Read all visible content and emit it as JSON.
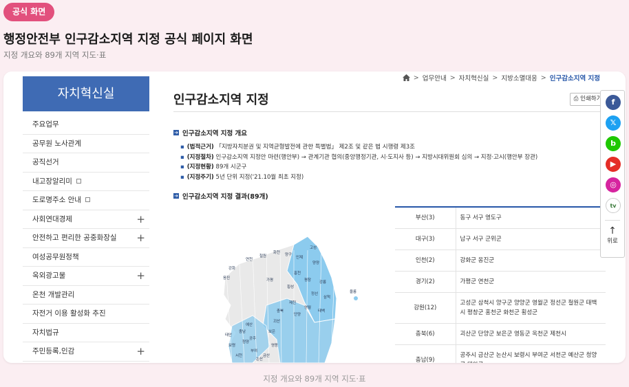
{
  "header": {
    "tag": "공식 화면",
    "headline": "행정안전부 인구감소지역 지정 공식 페이지 화면",
    "subline": "지정 개요와 89개 지역 지도·표",
    "caption": "지정 개요와 89개 지역 지도·표"
  },
  "sidebar": {
    "title": "자치혁신실",
    "items": [
      {
        "label": "주요업무",
        "ext": false,
        "plus": false
      },
      {
        "label": "공무원 노사관계",
        "ext": false,
        "plus": false
      },
      {
        "label": "공직선거",
        "ext": false,
        "plus": false
      },
      {
        "label": "내고장알리미",
        "ext": true,
        "plus": false
      },
      {
        "label": "도로명주소 안내",
        "ext": true,
        "plus": false
      },
      {
        "label": "사회연대경제",
        "ext": false,
        "plus": true
      },
      {
        "label": "안전하고 편리한 공중화장실",
        "ext": false,
        "plus": true
      },
      {
        "label": "여성공무원정책",
        "ext": false,
        "plus": false
      },
      {
        "label": "옥외광고물",
        "ext": false,
        "plus": true
      },
      {
        "label": "온천 개발관리",
        "ext": false,
        "plus": false
      },
      {
        "label": "자전거 이용 활성화 추진",
        "ext": false,
        "plus": false
      },
      {
        "label": "자치법규",
        "ext": false,
        "plus": false
      },
      {
        "label": "주민등록,인감",
        "ext": false,
        "plus": true
      }
    ]
  },
  "breadcrumb": [
    "업무안내",
    "자치혁신실",
    "지방소멸대응",
    "인구감소지역 지정"
  ],
  "page": {
    "title": "인구감소지역 지정",
    "print_label": "인쇄하기",
    "section1": "인구감소지역 지정 개요",
    "bullets": [
      {
        "key": "(법적근거)",
        "text": " 「지방자치분권 및 지역균형발전에 관한 특별법」 제2조 및 같은 법 시행령 제3조"
      },
      {
        "key": "(지정절차)",
        "text": " 인구감소지역 지정안 마련(행안부) → 관계기관 협의(중앙행정기관, 시·도지사 등) → 지방시대위원회 심의 → 지정·고시(행안부 장관)"
      },
      {
        "key": "(지정현황)",
        "text": " 89개 시군구"
      },
      {
        "key": "(지정주기)",
        "text": " 5년 단위 지정('21.10월 최초 지정)"
      }
    ],
    "section2": "인구감소지역 지정 결과(89개)"
  },
  "table": [
    {
      "region": "부산(3)",
      "list": "동구 서구 영도구"
    },
    {
      "region": "대구(3)",
      "list": "남구 서구 군위군"
    },
    {
      "region": "인천(2)",
      "list": "강화군 옹진군"
    },
    {
      "region": "경기(2)",
      "list": "가평군 연천군"
    },
    {
      "region": "강원(12)",
      "list": "고성군 삼척시 양구군 양양군 영월군 정선군 철원군 태백시 평창군 홍천군 화천군 횡성군"
    },
    {
      "region": "충북(6)",
      "list": "괴산군 단양군 보은군 영동군 옥천군 제천시"
    },
    {
      "region": "충남(9)",
      "list": "공주시 금산군 논산시 보령시 부여군 서천군 예산군 청양군 태안군"
    }
  ],
  "map": {
    "labels": [
      "강화",
      "옹진",
      "연천",
      "가평",
      "철원",
      "화천",
      "양구",
      "인제",
      "고성",
      "양양",
      "홍천",
      "횡성",
      "평창",
      "정선",
      "영월",
      "태백",
      "삼척",
      "강릉",
      "충북",
      "괴산",
      "보은",
      "영동",
      "단양",
      "제천",
      "충남",
      "청양",
      "부여",
      "서천",
      "논산",
      "공주",
      "금산",
      "태안",
      "보령",
      "예산",
      "울릉"
    ],
    "accent": "#8ccbee",
    "base": "#e9e9e9"
  },
  "floating": {
    "sns": [
      {
        "icon": "facebook-icon",
        "glyph": "f",
        "color": "#3b5998"
      },
      {
        "icon": "x-icon",
        "glyph": "𝕏",
        "color": "#1da1f2"
      },
      {
        "icon": "band-icon",
        "glyph": "b",
        "color": "#1ec800"
      },
      {
        "icon": "youtube-icon",
        "glyph": "▶",
        "color": "#e52d27"
      },
      {
        "icon": "instagram-icon",
        "glyph": "◎",
        "color": "#d6249f"
      },
      {
        "icon": "tv-icon",
        "glyph": "tv",
        "color": "#ffffff"
      }
    ],
    "top_label": "위로"
  }
}
